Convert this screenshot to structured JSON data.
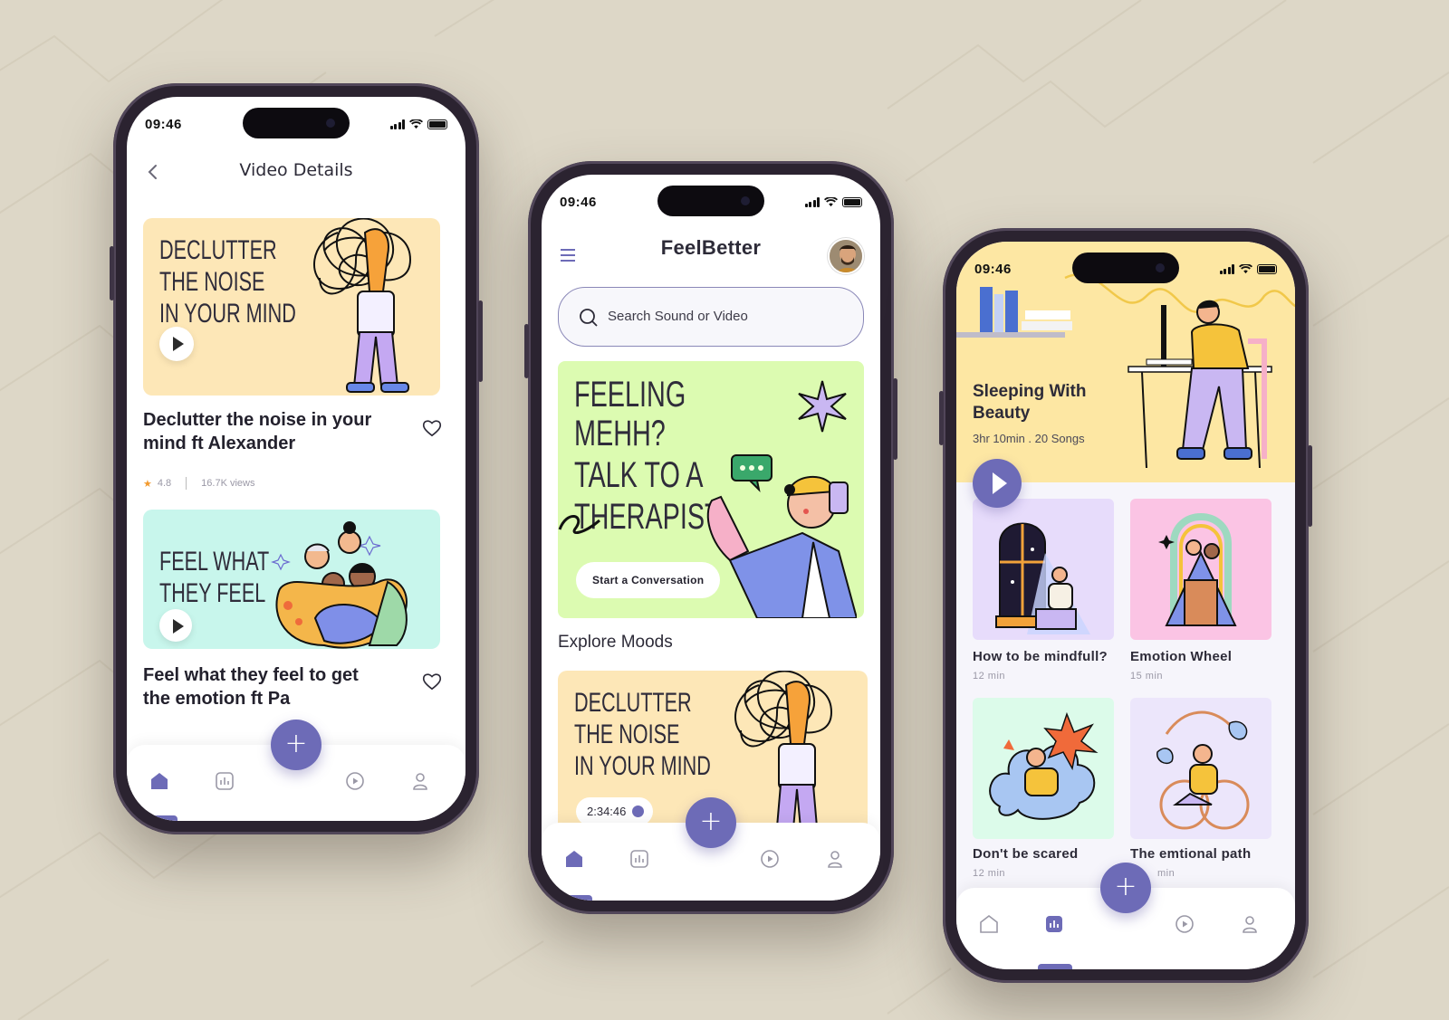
{
  "colors": {
    "background": "#ddd7c7",
    "accent": "#6d6bb7",
    "promo_green": "#dcfbb1",
    "card_yellow": "#fde7b7",
    "card_mint": "#c8f6ec"
  },
  "status": {
    "time": "09:46"
  },
  "phone1": {
    "header_title": "Video Details",
    "cards": [
      {
        "art_lines": [
          "DECLUTTER",
          "THE NOISE",
          "IN YOUR MIND"
        ],
        "title_lines": [
          "Declutter the noise in your",
          "mind ft Alexander"
        ],
        "rating": "4.8",
        "views": "16.7K views"
      },
      {
        "art_lines": [
          "FEEL WHAT",
          "THEY FEEL"
        ],
        "title_lines": [
          "Feel what they feel to get",
          "the emotion ft Pa"
        ]
      }
    ]
  },
  "phone2": {
    "app_title": "FeelBetter",
    "search": {
      "placeholder": "Search Sound or Video"
    },
    "promo": {
      "lines": [
        "FEELING MEHH?",
        "TALK TO A",
        "THERAPIST."
      ],
      "button": "Start a Conversation"
    },
    "section_title": "Explore Moods",
    "card": {
      "art_lines": [
        "DECLUTTER",
        "THE NOISE",
        "IN YOUR MIND"
      ],
      "duration": "2:34:46"
    }
  },
  "phone3": {
    "hero": {
      "title_lines": [
        "Sleeping With",
        "Beauty"
      ],
      "subtitle": "3hr 10min . 20 Songs"
    },
    "tiles": [
      {
        "label": "How to be mindfull?",
        "duration": "12 min",
        "bg": "#e7dcfb"
      },
      {
        "label": "Emotion Wheel",
        "duration": "15 min",
        "bg": "#fbc4e4"
      },
      {
        "label": "Don't be scared",
        "duration": "12 min",
        "bg": "#dcfbea"
      },
      {
        "label": "The emtional path",
        "duration": "min",
        "bg": "#ece6fb"
      }
    ]
  },
  "nav": {
    "fab_symbol": "+"
  }
}
